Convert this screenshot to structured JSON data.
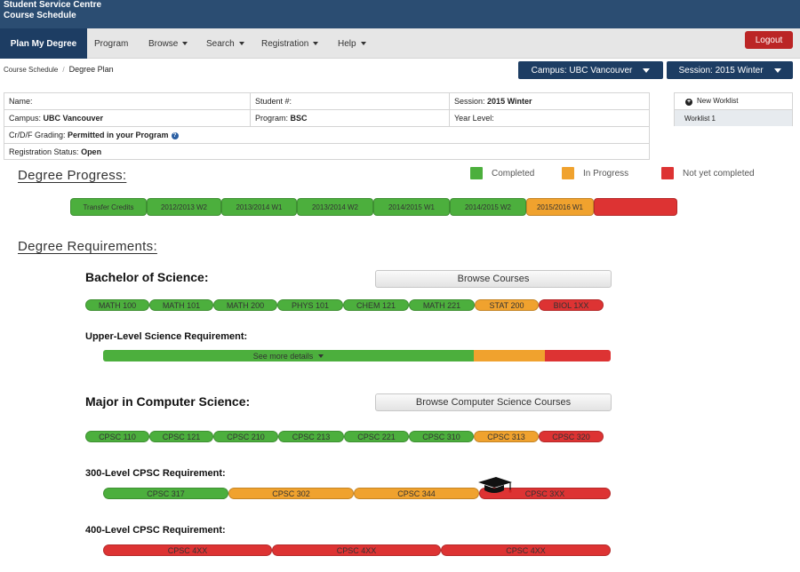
{
  "header": {
    "title_line1": "Student Service Centre",
    "title_line2": "Course Schedule"
  },
  "nav": {
    "active": "Plan My Degree",
    "program": "Program",
    "browse": "Browse",
    "search": "Search",
    "registration": "Registration",
    "help": "Help",
    "logout": "Logout"
  },
  "breadcrumb": {
    "parent": "Course Schedule",
    "separator": "/",
    "current": "Degree Plan"
  },
  "selectors": {
    "campus": "Campus: UBC Vancouver",
    "session": "Session: 2015 Winter"
  },
  "info": {
    "name_label": "Name:",
    "name_value": "",
    "student_label": "Student #:",
    "student_value": "",
    "session_label": "Session:",
    "session_value": "2015 Winter",
    "campus_label": "Campus:",
    "campus_value": "UBC Vancouver",
    "program_label": "Program:",
    "program_value": "BSC",
    "year_label": "Year Level:",
    "year_value": "",
    "grading_label": "Cr/D/F Grading:",
    "grading_value": "Permitted in your Program",
    "reg_label": "Registration Status:",
    "reg_value": "Open"
  },
  "worklist": {
    "new_label": "New Worklist",
    "items": [
      "Worklist 1"
    ]
  },
  "colors": {
    "completed": "#4caf3d",
    "in_progress": "#f0a22e",
    "not_completed": "#dd3333"
  },
  "degree_progress": {
    "title": "Degree Progress:",
    "legend": {
      "completed": "Completed",
      "in_progress": "In Progress",
      "not_completed": "Not yet completed"
    },
    "segments": [
      {
        "label": "Transfer Credits",
        "status": "completed"
      },
      {
        "label": "2012/2013 W2",
        "status": "completed"
      },
      {
        "label": "2013/2014 W1",
        "status": "completed"
      },
      {
        "label": "2013/2014 W2",
        "status": "completed"
      },
      {
        "label": "2014/2015 W1",
        "status": "completed"
      },
      {
        "label": "2014/2015 W2",
        "status": "completed"
      },
      {
        "label": "2015/2016 W1",
        "status": "in_progress"
      },
      {
        "label": "",
        "status": "not_completed"
      }
    ]
  },
  "requirements": {
    "title": "Degree Requirements:",
    "bachelor": {
      "title": "Bachelor of Science:",
      "browse_label": "Browse Courses",
      "courses": [
        {
          "label": "MATH 100",
          "status": "completed"
        },
        {
          "label": "MATH 101",
          "status": "completed"
        },
        {
          "label": "MATH 200",
          "status": "completed"
        },
        {
          "label": "PHYS 101",
          "status": "completed"
        },
        {
          "label": "CHEM 121",
          "status": "completed"
        },
        {
          "label": "MATH 221",
          "status": "completed"
        },
        {
          "label": "STAT 200",
          "status": "in_progress"
        },
        {
          "label": "BIOL 1XX",
          "status": "not_completed"
        }
      ],
      "upper_level": {
        "title": "Upper-Level Science Requirement:",
        "see_more": "See more details",
        "completed_fraction": 0.73,
        "in_progress_fraction": 0.14,
        "not_completed_fraction": 0.13
      }
    },
    "major": {
      "title": "Major in Computer Science:",
      "browse_label": "Browse Computer Science Courses",
      "courses": [
        {
          "label": "CPSC 110",
          "status": "completed"
        },
        {
          "label": "CPSC 121",
          "status": "completed"
        },
        {
          "label": "CPSC 210",
          "status": "completed"
        },
        {
          "label": "CPSC 213",
          "status": "completed"
        },
        {
          "label": "CPSC 221",
          "status": "completed"
        },
        {
          "label": "CPSC 310",
          "status": "completed"
        },
        {
          "label": "CPSC 313",
          "status": "in_progress"
        },
        {
          "label": "CPSC 320",
          "status": "not_completed"
        }
      ],
      "level300": {
        "title": "300-Level CPSC Requirement:",
        "courses": [
          {
            "label": "CPSC 317",
            "status": "completed"
          },
          {
            "label": "CPSC 302",
            "status": "in_progress"
          },
          {
            "label": "CPSC 344",
            "status": "in_progress"
          },
          {
            "label": "CPSC 3XX",
            "status": "not_completed"
          }
        ]
      },
      "level400": {
        "title": "400-Level CPSC Requirement:",
        "courses": [
          {
            "label": "CPSC 4XX",
            "status": "not_completed"
          },
          {
            "label": "CPSC 4XX",
            "status": "not_completed"
          },
          {
            "label": "CPSC 4XX",
            "status": "not_completed"
          }
        ]
      }
    }
  }
}
